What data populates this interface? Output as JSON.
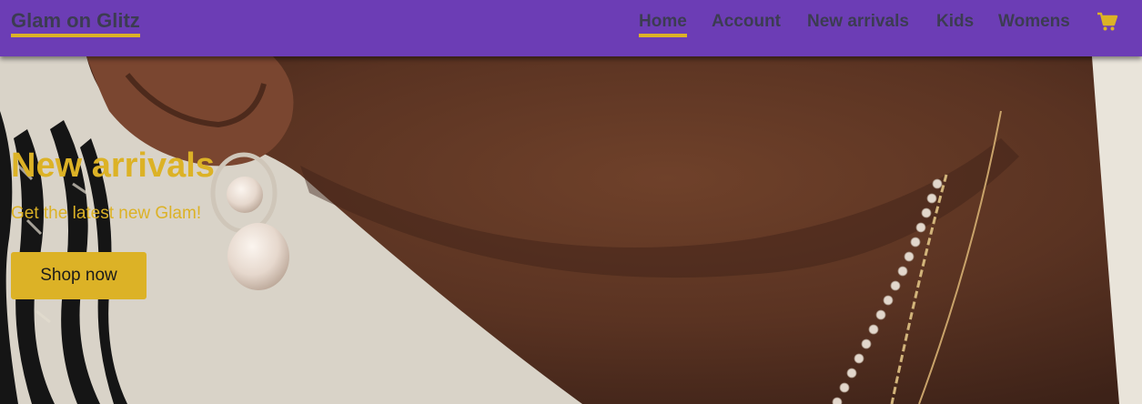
{
  "brand": {
    "name": "Glam on Glitz"
  },
  "nav": {
    "items": [
      {
        "label": "Home",
        "active": true
      },
      {
        "label": "Account",
        "active": false
      },
      {
        "label": "New arrivals",
        "active": false
      },
      {
        "label": "Kids",
        "active": false
      },
      {
        "label": "Womens",
        "active": false
      }
    ],
    "cart_icon": "shopping-cart-icon"
  },
  "hero": {
    "title": "New arrivals",
    "subtitle": "Get the latest new Glam!",
    "button_label": "Shop now",
    "image": "close-up of neck and ear wearing pearl earrings and necklaces"
  },
  "colors": {
    "navbar": "#6c3db5",
    "accent": "#dcb226",
    "nav_text": "#3c3c52"
  }
}
